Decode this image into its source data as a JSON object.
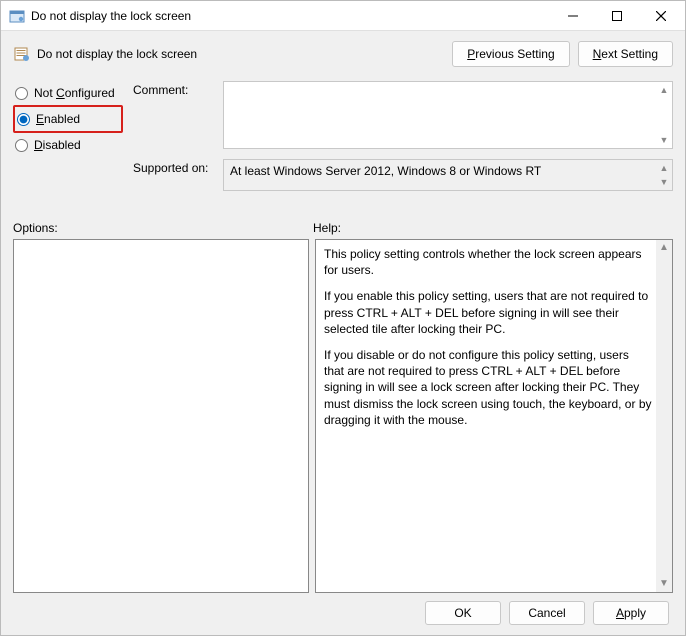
{
  "window": {
    "title": "Do not display the lock screen"
  },
  "header": {
    "title": "Do not display the lock screen",
    "previous_label": "Previous Setting",
    "previous_prefix": "P",
    "previous_rest": "revious Setting",
    "next_label": "Next Setting",
    "next_prefix": "N",
    "next_rest": "ext Setting"
  },
  "state": {
    "not_configured_label": "Not Configured",
    "not_configured_prefix": "Not ",
    "not_configured_ul": "C",
    "not_configured_rest": "onfigured",
    "enabled_label": "Enabled",
    "enabled_ul": "E",
    "enabled_rest": "nabled",
    "disabled_label": "Disabled",
    "disabled_ul": "D",
    "disabled_rest": "isabled",
    "selected": "enabled"
  },
  "labels": {
    "comment": "Comment:",
    "supported_on": "Supported on:",
    "options": "Options:",
    "help": "Help:"
  },
  "supported": {
    "text": "At least Windows Server 2012, Windows 8 or Windows RT"
  },
  "help": {
    "p1": "This policy setting controls whether the lock screen appears for users.",
    "p2": "If you enable this policy setting, users that are not required to press CTRL + ALT + DEL before signing in will see their selected tile after locking their PC.",
    "p3": "If you disable or do not configure this policy setting, users that are not required to press CTRL + ALT + DEL before signing in will see a lock screen after locking their PC. They must dismiss the lock screen using touch, the keyboard, or by dragging it with the mouse."
  },
  "footer": {
    "ok": "OK",
    "cancel": "Cancel",
    "apply_ul": "A",
    "apply_rest": "pply"
  }
}
